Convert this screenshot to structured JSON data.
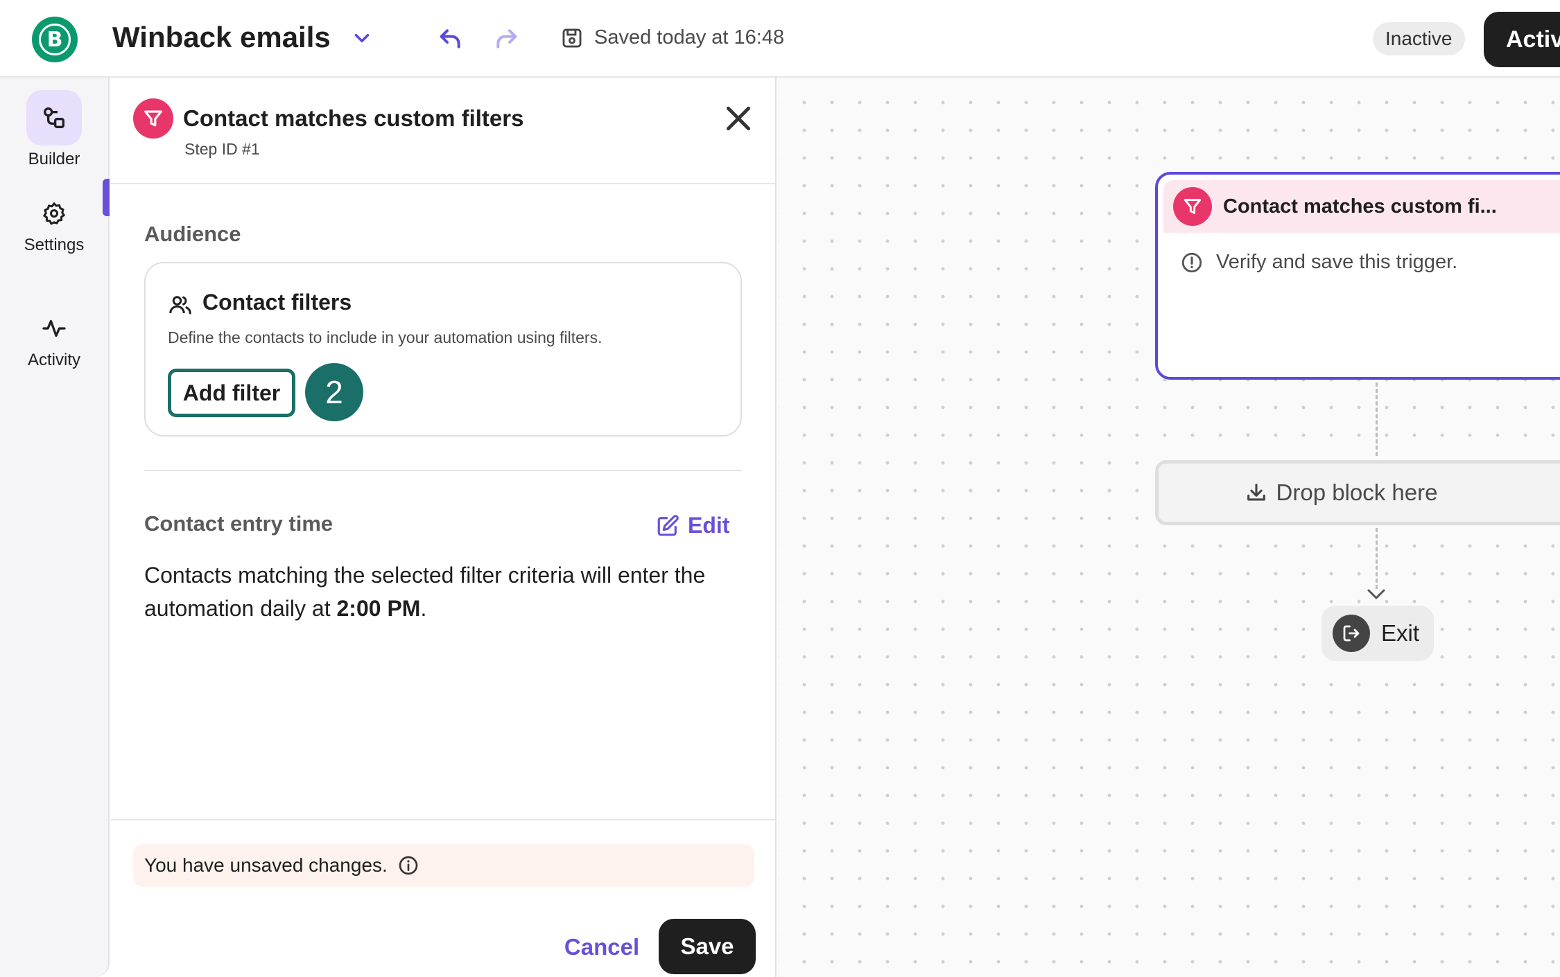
{
  "header": {
    "logo_letter": "B",
    "title": "Winback emails",
    "save_status": "Saved today at 16:48",
    "status_badge": "Inactive",
    "activate_label": "Activ"
  },
  "nav": {
    "items": [
      {
        "label": "Builder",
        "icon": "builder-icon"
      },
      {
        "label": "Settings",
        "icon": "gear-icon"
      },
      {
        "label": "Activity",
        "icon": "activity-icon"
      }
    ]
  },
  "panel": {
    "title": "Contact matches custom filters",
    "subtitle": "Step ID #1",
    "audience_heading": "Audience",
    "filters_title": "Contact filters",
    "filters_desc": "Define the contacts to include in your automation using filters.",
    "add_filter_label": "Add filter",
    "step_marker": "2",
    "entry_heading": "Contact entry time",
    "edit_label": "Edit",
    "entry_text_prefix": "Contacts matching the selected filter criteria will enter the automation daily at ",
    "entry_time": "2:00 PM",
    "entry_text_suffix": ".",
    "unsaved_message": "You have unsaved changes.",
    "cancel_label": "Cancel",
    "save_label": "Save"
  },
  "canvas": {
    "trigger_title": "Contact matches custom fi...",
    "trigger_warning": "Verify and save this trigger.",
    "drop_label": "Drop block here",
    "exit_label": "Exit"
  },
  "colors": {
    "accent": "#6a4fd8",
    "brand": "#0b996e",
    "trigger": "#e8366b",
    "highlight": "#1a6f68"
  }
}
